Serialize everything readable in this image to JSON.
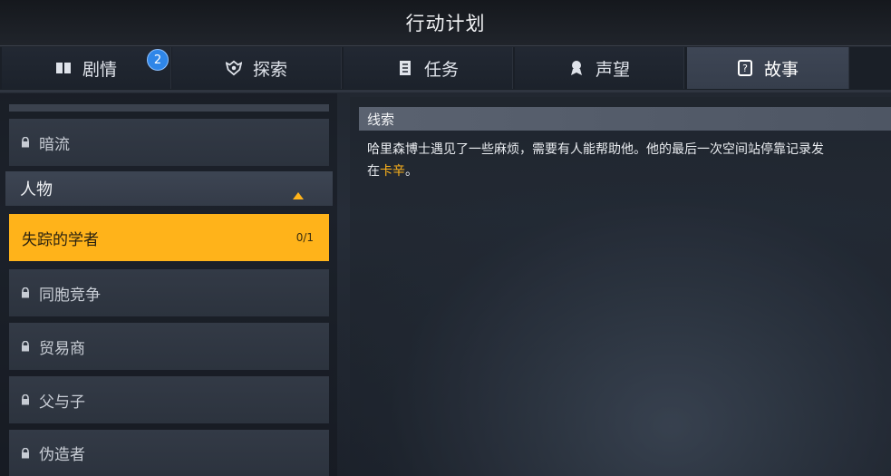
{
  "header": {
    "title": "行动计划"
  },
  "tabs": [
    {
      "label": "剧情",
      "icon": "book-icon",
      "badge": "2"
    },
    {
      "label": "探索",
      "icon": "emblem-icon"
    },
    {
      "label": "任务",
      "icon": "document-icon"
    },
    {
      "label": "声望",
      "icon": "medal-icon"
    },
    {
      "label": "故事",
      "icon": "question-book-icon",
      "active": true
    }
  ],
  "sidebar": {
    "items_top": [
      {
        "label": "暗流",
        "locked": true
      }
    ],
    "group": {
      "label": "人物",
      "expanded": true
    },
    "selected": {
      "label": "失踪的学者",
      "count": "0/1"
    },
    "items": [
      {
        "label": "同胞竞争",
        "locked": true
      },
      {
        "label": "贸易商",
        "locked": true
      },
      {
        "label": "父与子",
        "locked": true
      },
      {
        "label": "伪造者",
        "locked": true
      }
    ]
  },
  "detail": {
    "section_title": "线索",
    "clue_line1": "哈里森博士遇见了一些麻烦，需要有人能帮助他。他的最后一次空间站停靠记录发",
    "clue_prefix": "在",
    "clue_highlight": "卡辛",
    "clue_suffix": "。"
  },
  "colors": {
    "accent": "#ffb31a",
    "badge": "#2f86e8",
    "active_tab": "#3e4655"
  }
}
